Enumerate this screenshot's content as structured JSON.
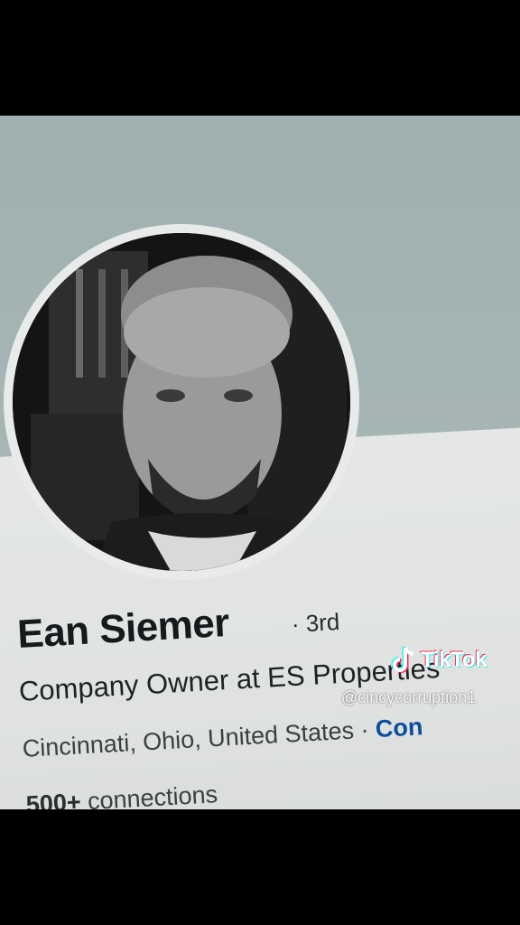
{
  "profile": {
    "name": "Ean Siemer",
    "degree": "· 3rd",
    "headline": "Company Owner at ES Properties",
    "location": "Cincinnati, Ohio, United States",
    "location_separator": " · ",
    "contact_label": "Con",
    "connections_count": "500+",
    "connections_label": " connections"
  },
  "watermark": {
    "brand": "TikTok",
    "handle": "@cincycorruption1",
    "icon": "tiktok-note-icon"
  },
  "colors": {
    "banner": "#a7b6b5",
    "card": "#e2e5e3",
    "name_text": "#171a1c",
    "link": "#0b4f9c"
  }
}
